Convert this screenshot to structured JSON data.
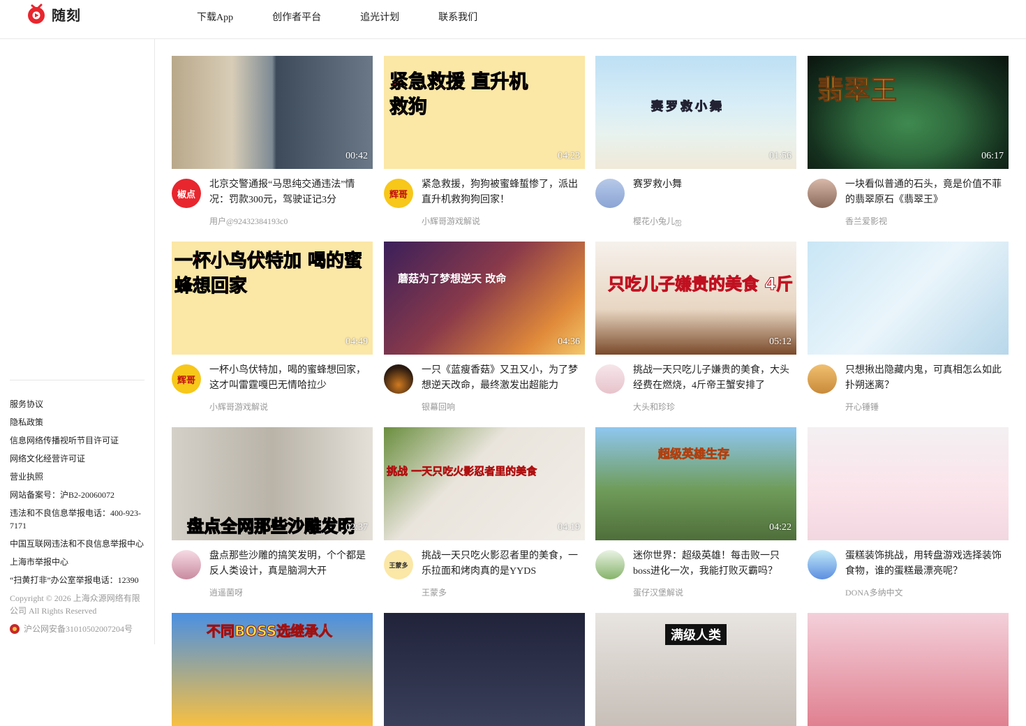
{
  "brand": {
    "name": "随刻",
    "color": "#e8262e"
  },
  "nav": [
    "下载App",
    "创作者平台",
    "追光计划",
    "联系我们"
  ],
  "sidebar": {
    "links": [
      "服务协议",
      "隐私政策",
      "信息网络传播视听节目许可证",
      "网络文化经营许可证",
      "营业执照",
      "网站备案号：沪B2-20060072",
      "违法和不良信息举报电话：400-923-7171",
      "中国互联网违法和不良信息举报中心",
      "上海市举报中心",
      "“扫黄打非”办公室举报电话：12390"
    ],
    "copyright": "Copyright © 2026 上海众源网络有限公司 All Rights Reserved",
    "police": "沪公网安备31010502007204号"
  },
  "videos": [
    {
      "title": "北京交警通报“马思纯交通违法”情况：罚款300元，驾驶证记3分",
      "author": "用户@92432384193c0",
      "duration": "00:42",
      "overlay": "",
      "avatar_text": "椒点"
    },
    {
      "title": "紧急救援，狗狗被蜜蜂蜇惨了，派出直升机救狗狗回家！",
      "author": "小辉哥游戏解说",
      "duration": "04:23",
      "overlay": "紧急救援 直升机救狗",
      "avatar_text": "辉哥"
    },
    {
      "title": "赛罗救小舞",
      "author": "樱花小兔儿ஐ",
      "duration": "01:56",
      "overlay": "赛罗救小舞",
      "avatar_text": ""
    },
    {
      "title": "一块看似普通的石头，竟是价值不菲的翡翠原石《翡翠王》",
      "author": "香兰爱影视",
      "duration": "06:17",
      "overlay": "翡翠王",
      "avatar_text": ""
    },
    {
      "title": "一杯小鸟伏特加，喝的蜜蜂想回家，这才叫雷霆嘎巴无情哈拉少",
      "author": "小辉哥游戏解说",
      "duration": "04:49",
      "overlay": "一杯小鸟伏特加 喝的蜜蜂想回家",
      "avatar_text": "辉哥"
    },
    {
      "title": "一只《蓝瘦香菇》又丑又小，为了梦想逆天改命，最终激发出超能力",
      "author": "银幕回响",
      "duration": "04:36",
      "overlay": "蘑菇为了梦想逆天 改命",
      "avatar_text": ""
    },
    {
      "title": "挑战一天只吃儿子嫌贵的美食，大头经费在燃烧，4斤帝王蟹安排了",
      "author": "大头和珍珍",
      "duration": "05:12",
      "overlay": "只吃儿子嫌贵的美食 4斤帝王蟹",
      "avatar_text": ""
    },
    {
      "title": "只想揪出隐藏内鬼，可真相怎么如此扑朔迷离？",
      "author": "开心锤锤",
      "duration": "",
      "overlay": "",
      "avatar_text": ""
    },
    {
      "title": "盘点那些沙雕的搞笑发明，个个都是反人类设计，真是脑洞大开",
      "author": "逍遥菌呀",
      "duration": "02:37",
      "overlay": "盘点全网那些沙雕发明",
      "avatar_text": ""
    },
    {
      "title": "挑战一天只吃火影忍者里的美食，一乐拉面和烤肉真的是YYDS",
      "author": "王蒙多",
      "duration": "04:19",
      "overlay": "挑战 一天只吃火影忍者里的美食",
      "avatar_text": "王蒙多"
    },
    {
      "title": "迷你世界：超级英雄！每击败一只boss进化一次，我能打败灭霸吗？",
      "author": "蛋仔汉堡解说",
      "duration": "04:22",
      "overlay": "超级英雄生存",
      "avatar_text": ""
    },
    {
      "title": "蛋糕装饰挑战，用转盘游戏选择装饰食物，谁的蛋糕最漂亮呢？",
      "author": "DONA多纳中文",
      "duration": "",
      "overlay": "",
      "avatar_text": ""
    },
    {
      "title": "",
      "author": "",
      "duration": "",
      "overlay": "不同BOSS选继承人",
      "avatar_text": ""
    },
    {
      "title": "",
      "author": "",
      "duration": "",
      "overlay": "",
      "avatar_text": ""
    },
    {
      "title": "",
      "author": "",
      "duration": "",
      "overlay": "满级人类",
      "avatar_text": ""
    },
    {
      "title": "",
      "author": "",
      "duration": "",
      "overlay": "",
      "avatar_text": ""
    }
  ],
  "icons": {
    "logo": "play-circle-icon",
    "police": "police-badge-icon"
  }
}
